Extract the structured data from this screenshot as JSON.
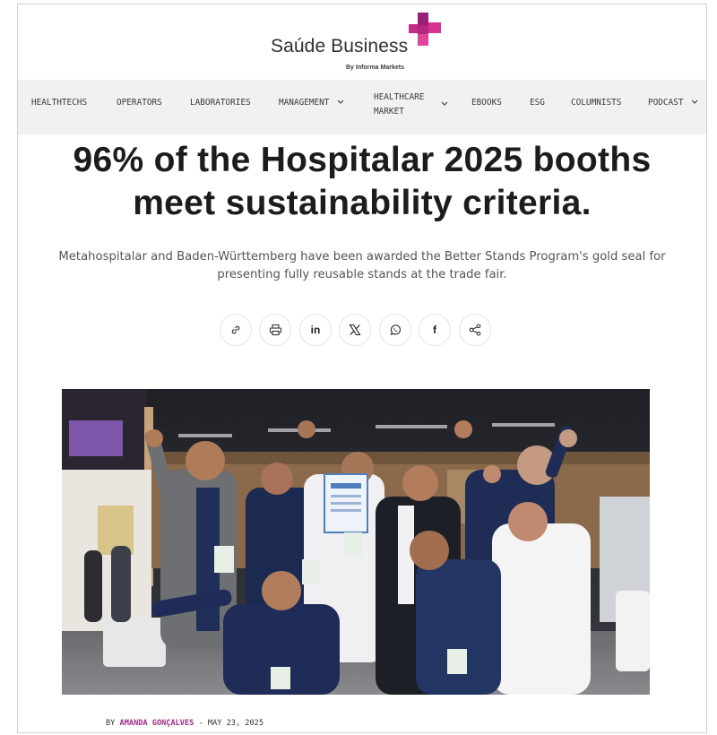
{
  "brand": {
    "name": "Saúde Business",
    "tagline": "By Informa Markets",
    "accent_magenta": "#9b1f7a",
    "accent_pink": "#d9338f"
  },
  "nav": {
    "items": [
      {
        "label": "HEALTHTECHS",
        "has_dropdown": false
      },
      {
        "label": "OPERATORS",
        "has_dropdown": false
      },
      {
        "label": "LABORATORIES",
        "has_dropdown": false
      },
      {
        "label": "MANAGEMENT",
        "has_dropdown": true
      },
      {
        "label": "HEALTHCARE",
        "label_line2": "MARKET",
        "has_dropdown": true
      },
      {
        "label": "EBOOKS",
        "has_dropdown": false
      },
      {
        "label": "ESG",
        "has_dropdown": false
      },
      {
        "label": "COLUMNISTS",
        "has_dropdown": false
      },
      {
        "label": "PODCAST",
        "has_dropdown": true
      }
    ]
  },
  "article": {
    "headline_line1": "96% of the Hospitalar 2025 booths",
    "headline_line2": "meet sustainability criteria.",
    "subhead_line1": "Metahospitalar and Baden-Württemberg have been awarded the Better Stands Program's gold seal for",
    "subhead_line2": "presenting fully reusable stands at the trade fair.",
    "byline_prefix": "BY",
    "author": "AMANDA GONÇALVES",
    "separator": "-",
    "date": "MAY 23, 2025"
  },
  "share": {
    "buttons": [
      "link-icon",
      "print-icon",
      "linkedin-icon",
      "x-icon",
      "whatsapp-icon",
      "facebook-icon",
      "share-icon"
    ],
    "linkedin_glyph": "in",
    "facebook_glyph": "f"
  }
}
